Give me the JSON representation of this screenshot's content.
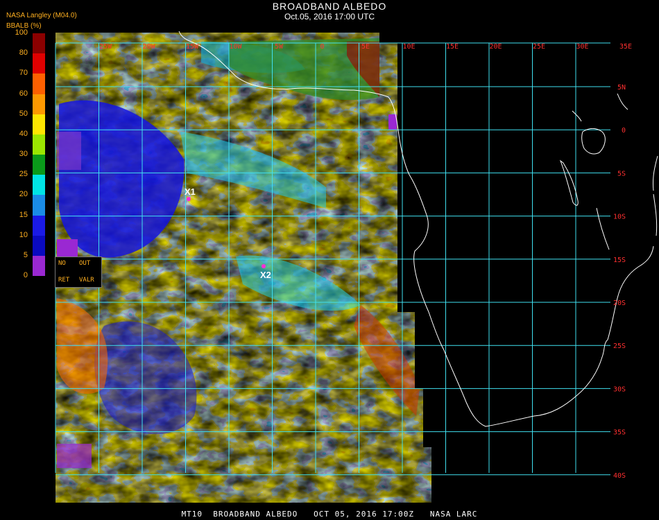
{
  "header": {
    "title": "BROADBAND ALBEDO",
    "subtitle": "Oct.05, 2016 17:00 UTC",
    "source": "NASA Langley (M04.0)"
  },
  "legend": {
    "title": "BBALB (%)",
    "ticks": [
      "100",
      "80",
      "70",
      "60",
      "50",
      "40",
      "30",
      "25",
      "20",
      "15",
      "10",
      "5",
      "0"
    ],
    "colors": [
      "#8b0000",
      "#e00000",
      "#ff6000",
      "#ff9900",
      "#ffe600",
      "#9be600",
      "#0a9a1a",
      "#00e5e5",
      "#1a8ce6",
      "#1a1ae6",
      "#0a0ac0",
      "#9a28d2"
    ],
    "flags": [
      "NO",
      "OUT",
      "RET",
      "VALR"
    ]
  },
  "map": {
    "lon_labels": [
      "25W",
      "20W",
      "15W",
      "10W",
      "5W",
      "0",
      "5E",
      "10E",
      "15E",
      "20E",
      "25E",
      "30E",
      "35E"
    ],
    "lat_labels": [
      "5N",
      "0",
      "5S",
      "10S",
      "15S",
      "20S",
      "25S",
      "30S",
      "35S",
      "40S"
    ],
    "markers": [
      {
        "label": "X1",
        "color": "#ff2cd8"
      },
      {
        "label": "X2",
        "color": "#ff2cd8"
      }
    ],
    "grid_color": "#40e0f0",
    "coast_color": "#ffffff"
  },
  "footer": "MT10  BROADBAND ALBEDO   OCT 05, 2016 17:00Z   NASA LARC"
}
